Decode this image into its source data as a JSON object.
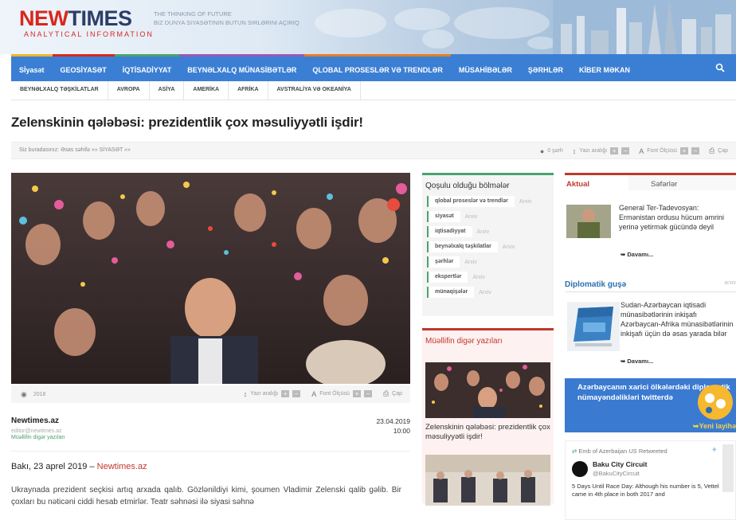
{
  "header": {
    "logo_new": "NEW",
    "logo_times": "TIMES",
    "logo_sub": "ANALYTICAL INFORMATION",
    "tagline_1": "THE THINKING OF FUTURE",
    "tagline_2": "BIZ DUNYA SIYASƏTININ BUTUN SIRLƏRINI AÇIRIQ"
  },
  "nav": {
    "items": [
      {
        "label": "Sİyasət",
        "color": "#f0b429"
      },
      {
        "label": "GEOSİYASƏT",
        "color": "#d9271d"
      },
      {
        "label": "İQTİSADİYYAT",
        "color": "#4aa36b"
      },
      {
        "label": "BEYNƏLXALQ MÜNASİBƏTLƏR",
        "color": "#9b59b6"
      },
      {
        "label": "QLOBAL PROSESLƏR VƏ TRENDLƏR",
        "color": "#e67e22"
      },
      {
        "label": "MÜSAHİBƏLƏR",
        "color": "#3b7fd4"
      },
      {
        "label": "ŞƏRHLƏR",
        "color": "#3b7fd4"
      },
      {
        "label": "KİBER MƏKAN",
        "color": "#3b7fd4"
      }
    ],
    "search_icon": "search-icon"
  },
  "subnav": {
    "items": [
      "BEYNƏLXALQ TƏŞKİLATLAR",
      "AVROPA",
      "ASİYA",
      "AMERİKA",
      "AFRİKA",
      "AVSTRALİYA VƏ OKEANİYA"
    ]
  },
  "article": {
    "title": "Zelenskinin qələbəsi: prezidentlik çox məsuliyyətli işdir!",
    "breadcrumb": "Siz buradasınız: Əsas səhifə »» SİYASƏT »»",
    "comments": "0 şərh",
    "line_spacing": "Yazı aralığı",
    "font_size": "Font Ölçüsü",
    "print": "Çap",
    "year": "2018",
    "source": "Newtimes.az",
    "email": "editor@newtimes.az",
    "author_other": "Müəllifin digər yazıları",
    "date": "23.04.2019",
    "time": "10:00",
    "lead_place": "Bakı, 23 aprel 2019 –",
    "lead_link": "Newtimes.az",
    "body": "Ukraynada prezident seçkisi artıq arxada qalıb. Gözlənildiyi kimi, şoumen Vladimir Zelenski qalib gəlib. Bir çoxları bu nəticəni ciddi hesab etmirlər. Teatr səhnəsi ilə siyasi səhnə"
  },
  "sections": {
    "heading": "Qoşulu olduğu bölmələr",
    "archive": "Arxiv",
    "items": [
      "qlobal proseslər və trendlər",
      "siyasət",
      "iqtisadiyyat",
      "beynəlxalq təşkilatlar",
      "şərhlər",
      "ekspertlər",
      "münaqişələr"
    ]
  },
  "other_posts": {
    "heading": "Müəllifin digər yazıları",
    "caption": "Zelenskinin qələbəsi: prezidentlik çox məsuliyyətli işdir!"
  },
  "sidebar": {
    "tab_actual": "Aktual",
    "tab_trips": "Səfərlər",
    "news_text": "General Ter-Tadevosyan: Ermənistan ordusu hücum əmrini yerinə yetirmək gücündə deyil",
    "more": "Davamı...",
    "dip_heading": "Diplomatik guşə",
    "dip_archive": "arxiv",
    "dip_text": "Sudan-Azərbaycan iqtisadi münasibətlərinin inkişafı Azərbaycan-Afrika münasibətlərinin inkişafı üçün də əsas yarada bilər",
    "tw_banner": "Azərbaycanın xarici ölkələrdəki diplomatik nümayəndəlikləri twitterdə",
    "tw_new": "Yeni layihə",
    "tweet_rt": "Emb of Azerbaijan US Retweeted",
    "tweet_name": "Baku City Circuit",
    "tweet_handle": "@BakuCityCircuit",
    "tweet_text": "5 Days Until Race Day: Although his number is 5, Vettel came in 4th place in both 2017 and"
  }
}
